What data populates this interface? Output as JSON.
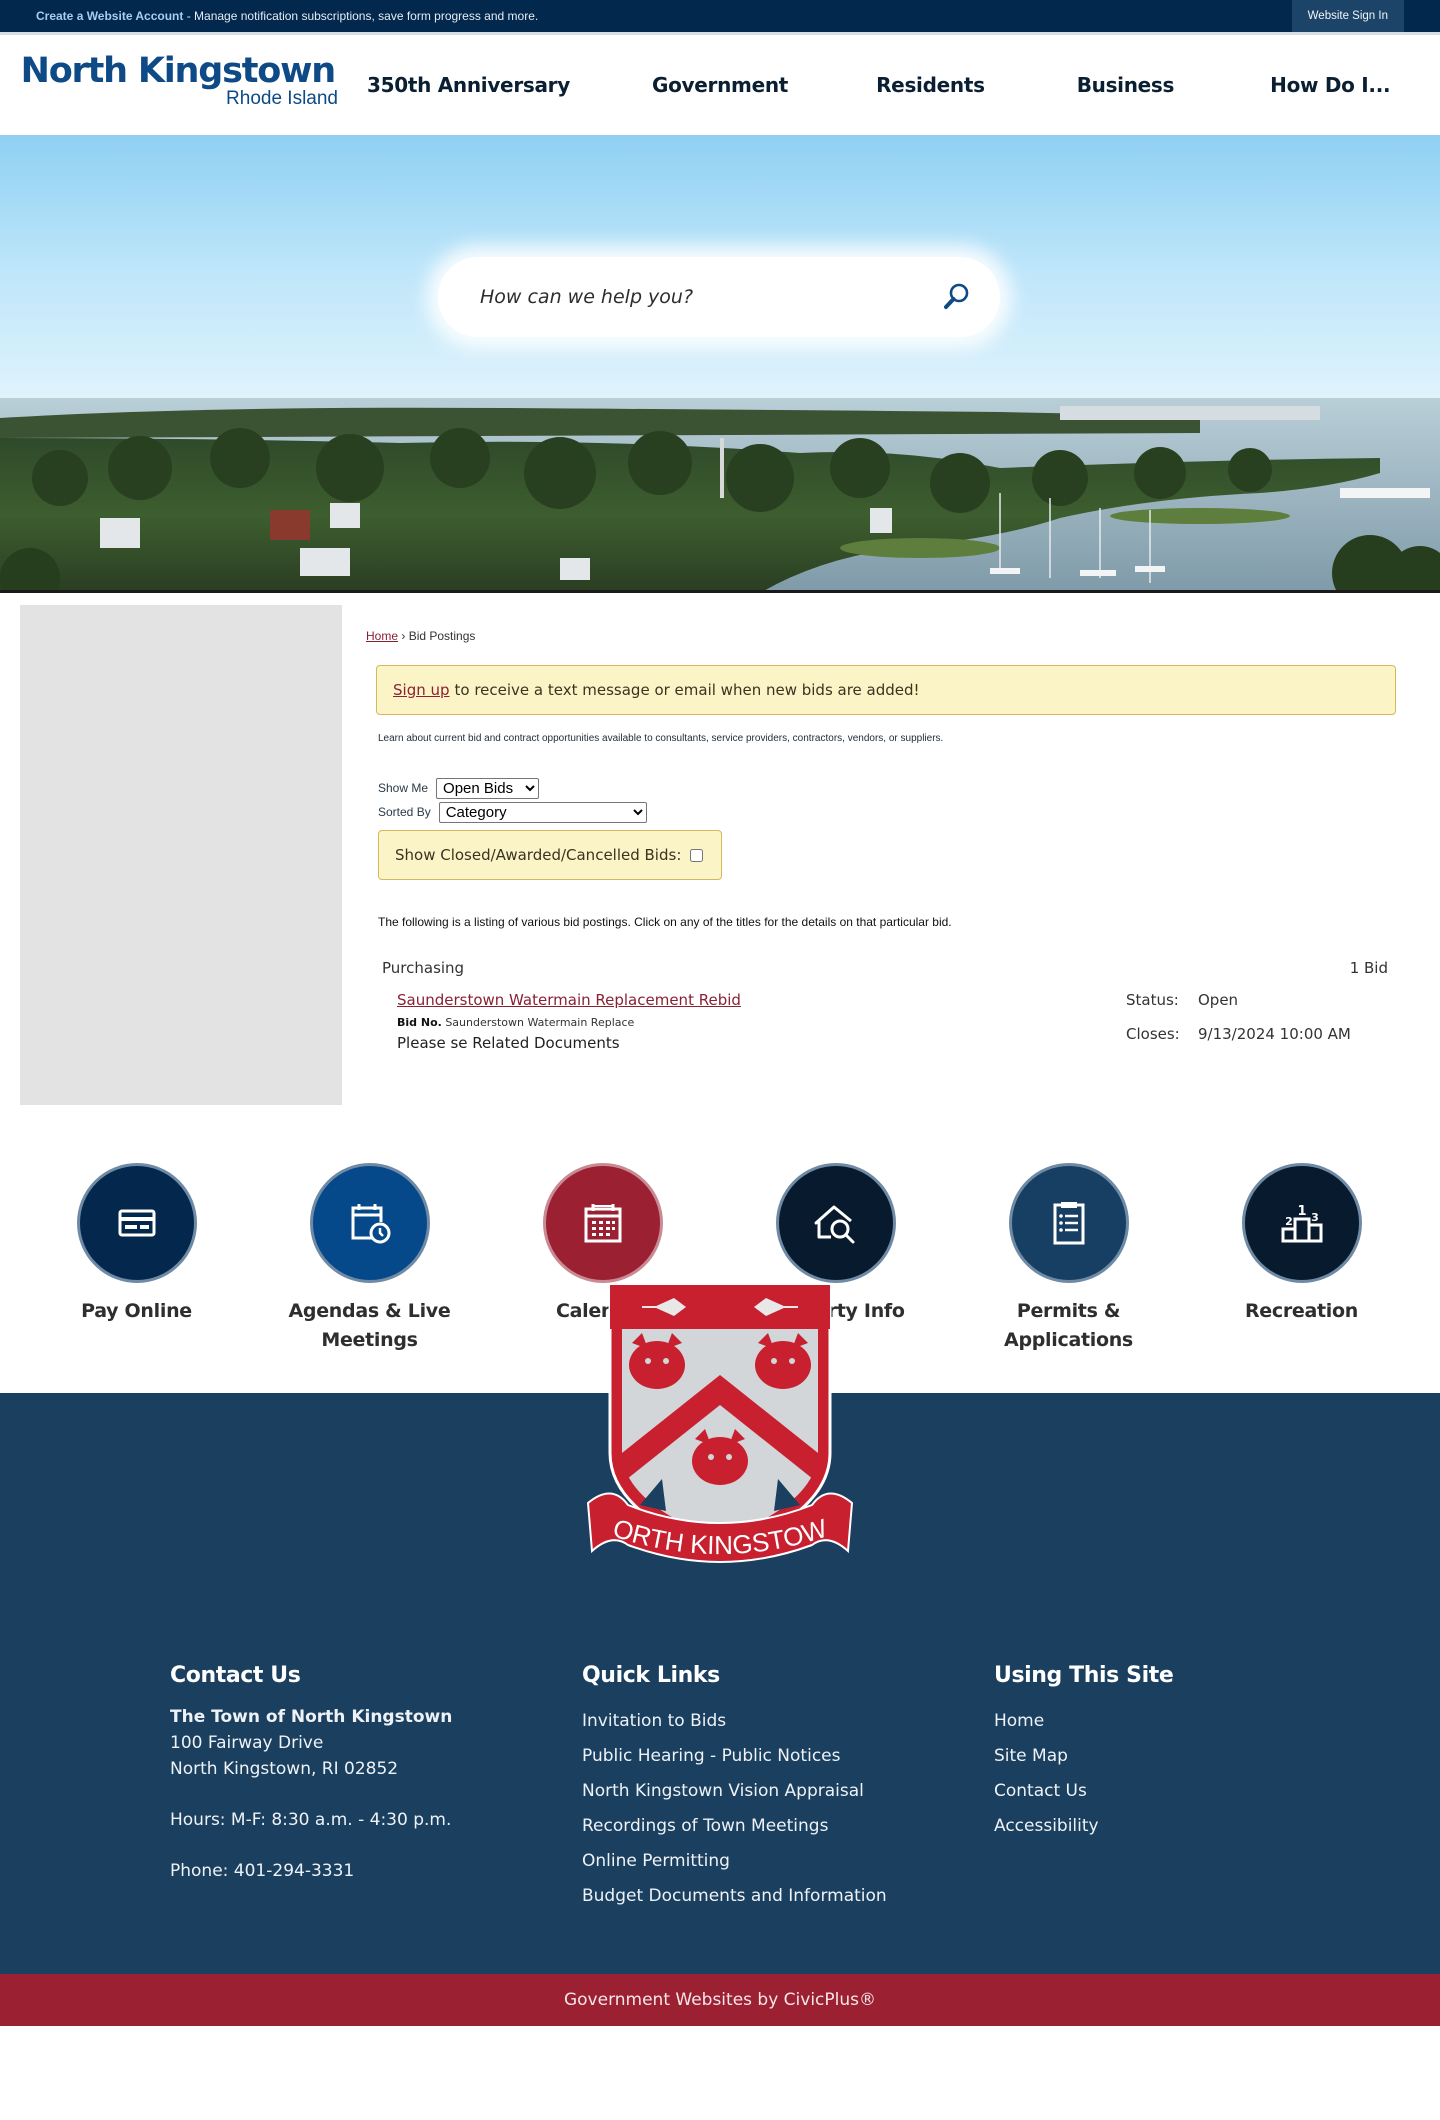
{
  "topbar": {
    "create_account": "Create a Website Account",
    "create_account_desc": " - Manage notification subscriptions, save form progress and more.",
    "sign_in": "Website Sign In"
  },
  "header": {
    "logo_line1": "North Kingstown",
    "logo_line2": "Rhode Island",
    "nav": [
      {
        "label": "350th Anniversary"
      },
      {
        "label": "Government"
      },
      {
        "label": "Residents"
      },
      {
        "label": "Business"
      },
      {
        "label": "How Do I..."
      }
    ]
  },
  "hero": {
    "search_placeholder": "How can we help you?",
    "search_icon": "search-icon"
  },
  "breadcrumb": {
    "home": "Home",
    "separator": " › ",
    "current": "Bid Postings"
  },
  "alert": {
    "link": "Sign up",
    "text": "to receive a text message or email when new bids are added!"
  },
  "intro": "Learn about current bid and contract opportunities available to consultants, service providers, contractors, vendors, or suppliers.",
  "filters": {
    "show_me_label": "Show Me",
    "show_me_value": "Open Bids",
    "sorted_by_label": "Sorted By",
    "sorted_by_value": "Category",
    "show_closed_label": "Show Closed/Awarded/Cancelled Bids:",
    "show_closed_checked": false
  },
  "listing_note": "The following is a listing of various bid postings. Click on any of the titles for the details on that particular bid.",
  "bids": {
    "category": "Purchasing",
    "count": "1 Bid",
    "items": [
      {
        "title": "Saunderstown Watermain Replacement Rebid",
        "bid_no_label": "Bid No.",
        "bid_no": "Saunderstown Watermain Replace",
        "description": "Please se Related Documents",
        "status_label": "Status:",
        "status": "Open",
        "closes_label": "Closes:",
        "closes": "9/13/2024 10:00 AM"
      }
    ]
  },
  "quick_links": [
    {
      "label": "Pay Online",
      "icon": "credit-card-icon",
      "color": "#04284d"
    },
    {
      "label": "Agendas & Live Meetings",
      "icon": "calendar-clock-icon",
      "color": "#06498a"
    },
    {
      "label": "Calendar",
      "icon": "calendar-icon",
      "color": "#9b2032"
    },
    {
      "label": "Property Info",
      "icon": "house-search-icon",
      "color": "#071a2e"
    },
    {
      "label": "Permits & Applications",
      "icon": "clipboard-list-icon",
      "color": "#173f63"
    },
    {
      "label": "Recreation",
      "icon": "podium-icon",
      "color": "#071a2e"
    }
  ],
  "crest": {
    "text": "NORTH KINGSTOWN"
  },
  "footer": {
    "contact": {
      "heading": "Contact Us",
      "name": "The Town of North Kingstown",
      "address1": "100 Fairway Drive",
      "address2": "North Kingstown, RI 02852",
      "hours": "Hours: M-F: 8:30 a.m. - 4:30 p.m.",
      "phone": "Phone: 401-294-3331"
    },
    "quick_links": {
      "heading": "Quick Links",
      "items": [
        "Invitation to Bids",
        "Public Hearing - Public Notices",
        "North Kingstown Vision Appraisal",
        "Recordings of Town Meetings",
        "Online Permitting",
        "Budget Documents and Information"
      ]
    },
    "using_site": {
      "heading": "Using This Site",
      "items": [
        "Home",
        "Site Map",
        "Contact Us",
        "Accessibility"
      ]
    },
    "credit": "Government Websites by CivicPlus®"
  },
  "colors": {
    "topbar": "#02284d",
    "brand_blue": "#0e4a86",
    "accent_red": "#9b2032",
    "footer_blue": "#1a3f5f",
    "alert_bg": "#fbf4c7"
  }
}
